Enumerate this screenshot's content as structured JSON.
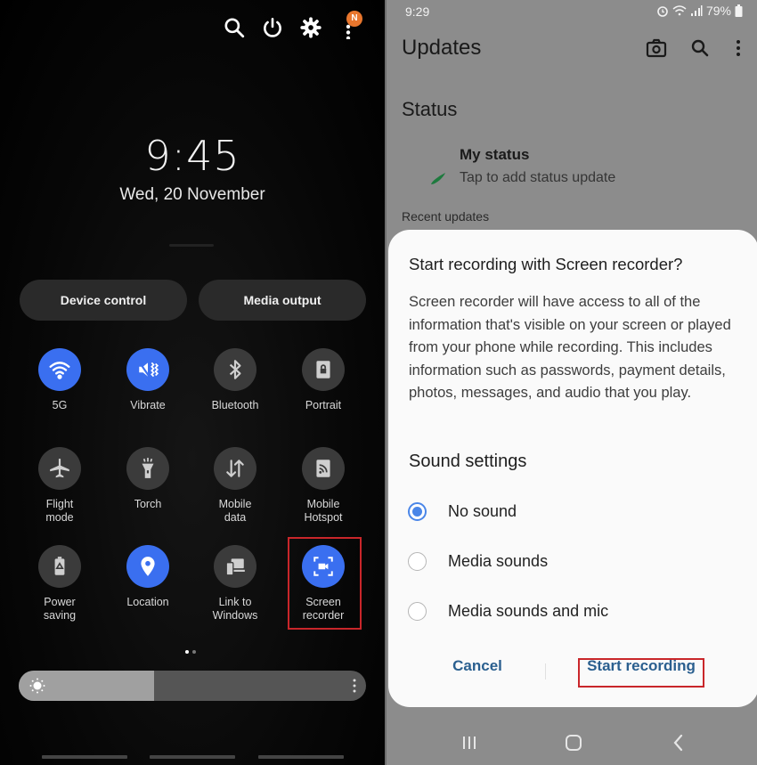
{
  "left": {
    "top_icons": [
      "search-icon",
      "power-icon",
      "settings-icon",
      "more-icon"
    ],
    "notification_badge": "N",
    "clock": "9:45",
    "date": "Wed, 20 November",
    "pills": [
      "Device control",
      "Media output"
    ],
    "tiles": [
      {
        "label": "5G",
        "icon": "wifi-icon",
        "on": true
      },
      {
        "label": "Vibrate",
        "icon": "vibrate-icon",
        "on": true
      },
      {
        "label": "Bluetooth",
        "icon": "bluetooth-icon",
        "on": false
      },
      {
        "label": "Portrait",
        "icon": "portrait-lock-icon",
        "on": false
      },
      {
        "label": "Flight\nmode",
        "icon": "airplane-icon",
        "on": false
      },
      {
        "label": "Torch",
        "icon": "torch-icon",
        "on": false
      },
      {
        "label": "Mobile\ndata",
        "icon": "mobile-data-icon",
        "on": false
      },
      {
        "label": "Mobile\nHotspot",
        "icon": "hotspot-icon",
        "on": false
      },
      {
        "label": "Power\nsaving",
        "icon": "power-saving-icon",
        "on": false
      },
      {
        "label": "Location",
        "icon": "location-icon",
        "on": true
      },
      {
        "label": "Link to\nWindows",
        "icon": "link-to-windows-icon",
        "on": false
      },
      {
        "label": "Screen\nrecorder",
        "icon": "screen-recorder-icon",
        "on": true
      }
    ],
    "page_indicator": {
      "pages": 2,
      "current": 1
    },
    "brightness_percent": 39
  },
  "right": {
    "status_bar": {
      "time": "9:29",
      "battery": "79%"
    },
    "app_title": "Updates",
    "status_header": "Status",
    "my_status": "My status",
    "my_status_sub": "Tap to add status update",
    "recent_updates": "Recent updates",
    "dialog": {
      "title": "Start recording with Screen recorder?",
      "body": "Screen recorder will have access to all of the information that's visible on your screen or played from your phone while recording. This includes information such as passwords, payment details, photos, messages, and audio that you play.",
      "sound_header": "Sound settings",
      "options": [
        {
          "label": "No sound",
          "selected": true
        },
        {
          "label": "Media sounds",
          "selected": false
        },
        {
          "label": "Media sounds and mic",
          "selected": false
        }
      ],
      "cancel": "Cancel",
      "confirm": "Start recording"
    }
  },
  "colors": {
    "accent_blue": "#3a6ff0",
    "highlight_red": "#c9262a",
    "button_text": "#2a5f8f"
  }
}
